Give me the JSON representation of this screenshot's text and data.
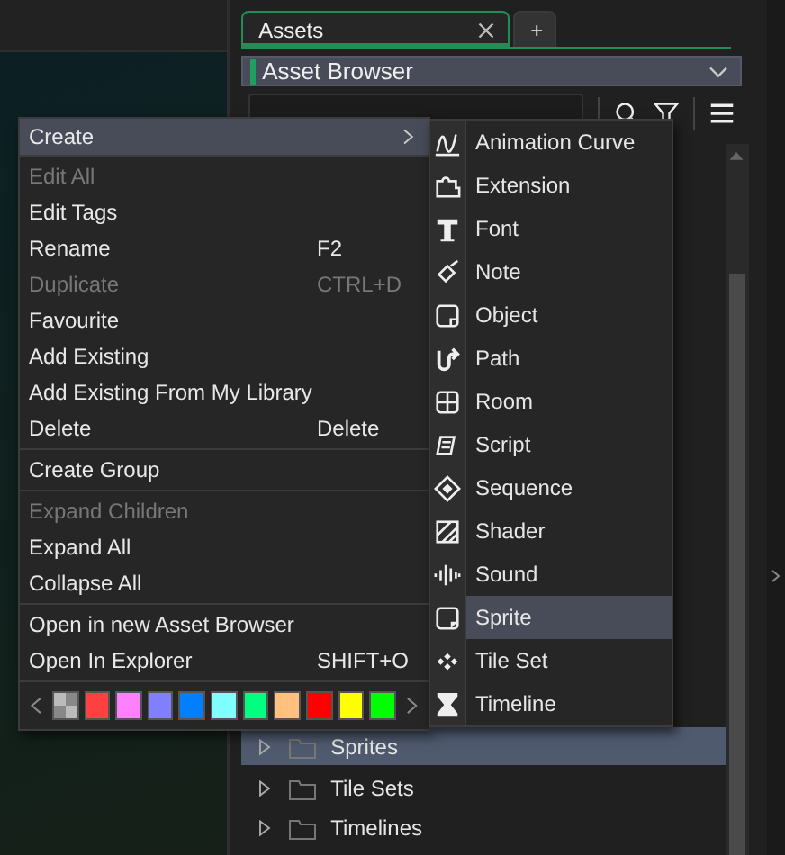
{
  "tabs": [
    {
      "label": "Assets",
      "selected": true,
      "closable": true
    },
    {
      "label": "+",
      "selected": false,
      "closable": false
    }
  ],
  "browser_select": {
    "value": "Asset Browser"
  },
  "tree": {
    "items": [
      {
        "label": "Sprites",
        "selected": true
      },
      {
        "label": "Tile Sets",
        "selected": false
      },
      {
        "label": "Timelines",
        "selected": false
      }
    ]
  },
  "context_menu": {
    "groups": [
      [
        {
          "label": "Create",
          "submenu": true,
          "selected": true,
          "disabled": false
        }
      ],
      [
        {
          "label": "Edit All",
          "disabled": true,
          "selected": false
        },
        {
          "label": "Edit Tags",
          "disabled": false,
          "selected": false
        },
        {
          "label": "Rename",
          "shortcut": "F2",
          "disabled": false,
          "selected": false
        },
        {
          "label": "Duplicate",
          "shortcut": "CTRL+D",
          "disabled": true,
          "selected": false
        },
        {
          "label": "Favourite",
          "disabled": false,
          "selected": false
        },
        {
          "label": "Add Existing",
          "disabled": false,
          "selected": false
        },
        {
          "label": "Add Existing From My Library",
          "disabled": false,
          "selected": false
        },
        {
          "label": "Delete",
          "shortcut": "Delete",
          "disabled": false,
          "selected": false
        }
      ],
      [
        {
          "label": "Create Group",
          "disabled": false,
          "selected": false
        }
      ],
      [
        {
          "label": "Expand Children",
          "disabled": true,
          "selected": false
        },
        {
          "label": "Expand All",
          "disabled": false,
          "selected": false
        },
        {
          "label": "Collapse All",
          "disabled": false,
          "selected": false
        }
      ],
      [
        {
          "label": "Open in new Asset Browser",
          "disabled": false,
          "selected": false
        },
        {
          "label": "Open In Explorer",
          "shortcut": "SHIFT+O",
          "disabled": false,
          "selected": false
        }
      ]
    ],
    "swatches": [
      {
        "kind": "none"
      },
      {
        "kind": "color",
        "color": "#ff4040"
      },
      {
        "kind": "color",
        "color": "#ff80ff"
      },
      {
        "kind": "color",
        "color": "#8080ff"
      },
      {
        "kind": "color",
        "color": "#0080ff"
      },
      {
        "kind": "color",
        "color": "#80ffff"
      },
      {
        "kind": "color",
        "color": "#00ff80"
      },
      {
        "kind": "color",
        "color": "#ffc080"
      },
      {
        "kind": "color",
        "color": "#ff0000"
      },
      {
        "kind": "color",
        "color": "#ffff00"
      },
      {
        "kind": "color",
        "color": "#00ff00"
      }
    ]
  },
  "submenu": {
    "items": [
      {
        "label": "Animation Curve",
        "selected": false
      },
      {
        "label": "Extension",
        "selected": false
      },
      {
        "label": "Font",
        "selected": false
      },
      {
        "label": "Note",
        "selected": false
      },
      {
        "label": "Object",
        "selected": false
      },
      {
        "label": "Path",
        "selected": false
      },
      {
        "label": "Room",
        "selected": false
      },
      {
        "label": "Script",
        "selected": false
      },
      {
        "label": "Sequence",
        "selected": false
      },
      {
        "label": "Shader",
        "selected": false
      },
      {
        "label": "Sound",
        "selected": false
      },
      {
        "label": "Sprite",
        "selected": true
      },
      {
        "label": "Tile Set",
        "selected": false
      },
      {
        "label": "Timeline",
        "selected": false
      }
    ]
  }
}
